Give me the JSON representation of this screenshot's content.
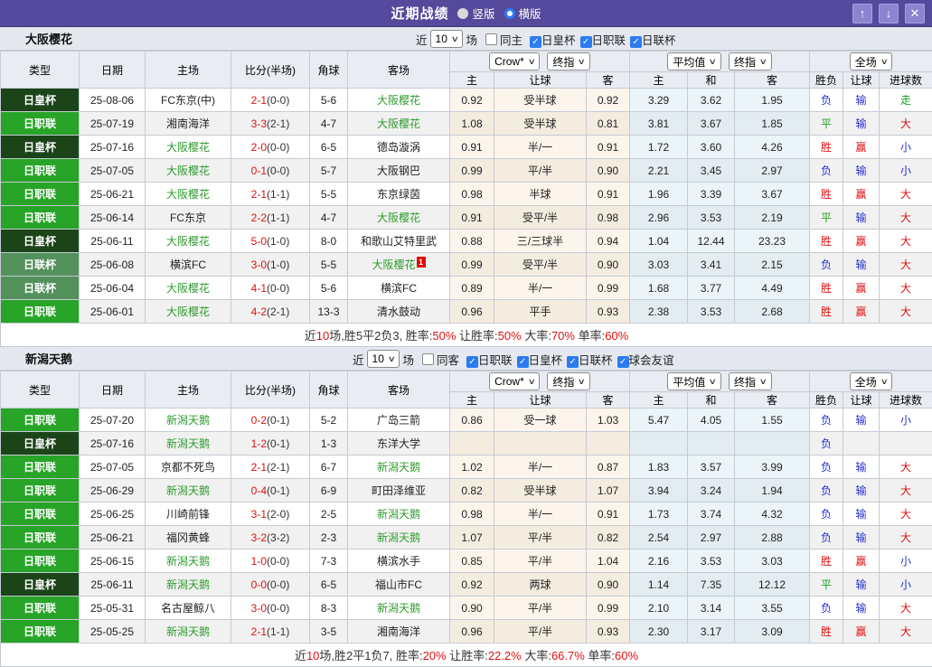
{
  "titlebar": {
    "title": "近期战绩",
    "radio_vertical": "竖版",
    "radio_horizontal": "横版",
    "up_icon": "↑",
    "down_icon": "↓",
    "close_icon": "✕"
  },
  "selects": {
    "crow": "Crow*",
    "final": "终指",
    "avg": "平均值",
    "full": "全场"
  },
  "filter_labels": {
    "near": "近",
    "games": "场"
  },
  "columns": [
    "类型",
    "日期",
    "主场",
    "比分(半场)",
    "角球",
    "客场",
    "主",
    "让球",
    "客",
    "主",
    "和",
    "客",
    "胜负",
    "让球",
    "进球数"
  ],
  "league_styles": {
    "日职联": "t-j1",
    "日皇杯": "t-cup",
    "日联杯": "t-lc"
  },
  "result_colors": {
    "胜": "res-red",
    "平": "res-green",
    "负": "res-blue",
    "赢": "res-red",
    "输": "res-blue",
    "大": "res-red",
    "小": "res-blue",
    "走": "res-green"
  },
  "sections": [
    {
      "team": "大阪樱花",
      "filters": {
        "count": "10",
        "same_label": "同主",
        "same_checked": false,
        "leagues": [
          "日皇杯",
          "日职联",
          "日联杯"
        ]
      },
      "rows": [
        {
          "league": "日皇杯",
          "date": "25-08-06",
          "home": "FC东京(中)",
          "score": "2-1",
          "half": "(0-0)",
          "corner": "5-6",
          "away": "大阪樱花",
          "badge": "",
          "crow_home": "0.92",
          "handicap": "受半球",
          "crow_away": "0.92",
          "avg_home": "3.29",
          "avg_draw": "3.62",
          "avg_away": "1.95",
          "result": "负",
          "handicap_result": "输",
          "goals_result": "走"
        },
        {
          "league": "日职联",
          "date": "25-07-19",
          "home": "湘南海洋",
          "score": "3-3",
          "half": "(2-1)",
          "corner": "4-7",
          "away": "大阪樱花",
          "badge": "",
          "crow_home": "1.08",
          "handicap": "受半球",
          "crow_away": "0.81",
          "avg_home": "3.81",
          "avg_draw": "3.67",
          "avg_away": "1.85",
          "result": "平",
          "handicap_result": "输",
          "goals_result": "大"
        },
        {
          "league": "日皇杯",
          "date": "25-07-16",
          "home": "大阪樱花",
          "score": "2-0",
          "half": "(0-0)",
          "corner": "6-5",
          "away": "德岛漩涡",
          "badge": "",
          "crow_home": "0.91",
          "handicap": "半/一",
          "crow_away": "0.91",
          "avg_home": "1.72",
          "avg_draw": "3.60",
          "avg_away": "4.26",
          "result": "胜",
          "handicap_result": "赢",
          "goals_result": "小"
        },
        {
          "league": "日职联",
          "date": "25-07-05",
          "home": "大阪樱花",
          "score": "0-1",
          "half": "(0-0)",
          "corner": "5-7",
          "away": "大阪钢巴",
          "badge": "",
          "crow_home": "0.99",
          "handicap": "平/半",
          "crow_away": "0.90",
          "avg_home": "2.21",
          "avg_draw": "3.45",
          "avg_away": "2.97",
          "result": "负",
          "handicap_result": "输",
          "goals_result": "小"
        },
        {
          "league": "日职联",
          "date": "25-06-21",
          "home": "大阪樱花",
          "score": "2-1",
          "half": "(1-1)",
          "corner": "5-5",
          "away": "东京绿茵",
          "badge": "",
          "crow_home": "0.98",
          "handicap": "半球",
          "crow_away": "0.91",
          "avg_home": "1.96",
          "avg_draw": "3.39",
          "avg_away": "3.67",
          "result": "胜",
          "handicap_result": "赢",
          "goals_result": "大"
        },
        {
          "league": "日职联",
          "date": "25-06-14",
          "home": "FC东京",
          "score": "2-2",
          "half": "(1-1)",
          "corner": "4-7",
          "away": "大阪樱花",
          "badge": "",
          "crow_home": "0.91",
          "handicap": "受平/半",
          "crow_away": "0.98",
          "avg_home": "2.96",
          "avg_draw": "3.53",
          "avg_away": "2.19",
          "result": "平",
          "handicap_result": "输",
          "goals_result": "大"
        },
        {
          "league": "日皇杯",
          "date": "25-06-11",
          "home": "大阪樱花",
          "score": "5-0",
          "half": "(1-0)",
          "corner": "8-0",
          "away": "和歌山艾特里武",
          "badge": "",
          "crow_home": "0.88",
          "handicap": "三/三球半",
          "crow_away": "0.94",
          "avg_home": "1.04",
          "avg_draw": "12.44",
          "avg_away": "23.23",
          "result": "胜",
          "handicap_result": "赢",
          "goals_result": "大"
        },
        {
          "league": "日联杯",
          "date": "25-06-08",
          "home": "横滨FC",
          "score": "3-0",
          "half": "(1-0)",
          "corner": "5-5",
          "away": "大阪樱花",
          "badge": "1",
          "crow_home": "0.99",
          "handicap": "受平/半",
          "crow_away": "0.90",
          "avg_home": "3.03",
          "avg_draw": "3.41",
          "avg_away": "2.15",
          "result": "负",
          "handicap_result": "输",
          "goals_result": "大"
        },
        {
          "league": "日联杯",
          "date": "25-06-04",
          "home": "大阪樱花",
          "score": "4-1",
          "half": "(0-0)",
          "corner": "5-6",
          "away": "横滨FC",
          "badge": "",
          "crow_home": "0.89",
          "handicap": "半/一",
          "crow_away": "0.99",
          "avg_home": "1.68",
          "avg_draw": "3.77",
          "avg_away": "4.49",
          "result": "胜",
          "handicap_result": "赢",
          "goals_result": "大"
        },
        {
          "league": "日职联",
          "date": "25-06-01",
          "home": "大阪樱花",
          "score": "4-2",
          "half": "(2-1)",
          "corner": "13-3",
          "away": "清水鼓动",
          "badge": "",
          "crow_home": "0.96",
          "handicap": "平手",
          "crow_away": "0.93",
          "avg_home": "2.38",
          "avg_draw": "3.53",
          "avg_away": "2.68",
          "result": "胜",
          "handicap_result": "赢",
          "goals_result": "大"
        }
      ],
      "summary": [
        {
          "text": "近",
          "red": false
        },
        {
          "text": "10",
          "red": true
        },
        {
          "text": "场,胜5平2负3, 胜率:",
          "red": false
        },
        {
          "text": "50%",
          "red": true
        },
        {
          "text": " 让胜率:",
          "red": false
        },
        {
          "text": "50%",
          "red": true
        },
        {
          "text": " 大率:",
          "red": false
        },
        {
          "text": "70%",
          "red": true
        },
        {
          "text": " 单率:",
          "red": false
        },
        {
          "text": "60%",
          "red": true
        }
      ]
    },
    {
      "team": "新潟天鹅",
      "filters": {
        "count": "10",
        "same_label": "同客",
        "same_checked": false,
        "leagues": [
          "日职联",
          "日皇杯",
          "日联杯",
          "球会友谊"
        ]
      },
      "rows": [
        {
          "league": "日职联",
          "date": "25-07-20",
          "home": "新潟天鹅",
          "score": "0-2",
          "half": "(0-1)",
          "corner": "5-2",
          "away": "广岛三箭",
          "badge": "",
          "crow_home": "0.86",
          "handicap": "受一球",
          "crow_away": "1.03",
          "avg_home": "5.47",
          "avg_draw": "4.05",
          "avg_away": "1.55",
          "result": "负",
          "handicap_result": "输",
          "goals_result": "小"
        },
        {
          "league": "日皇杯",
          "date": "25-07-16",
          "home": "新潟天鹅",
          "score": "1-2",
          "half": "(0-1)",
          "corner": "1-3",
          "away": "东洋大学",
          "badge": "",
          "crow_home": "",
          "handicap": "",
          "crow_away": "",
          "avg_home": "",
          "avg_draw": "",
          "avg_away": "",
          "result": "负",
          "handicap_result": "",
          "goals_result": ""
        },
        {
          "league": "日职联",
          "date": "25-07-05",
          "home": "京都不死鸟",
          "score": "2-1",
          "half": "(2-1)",
          "corner": "6-7",
          "away": "新潟天鹅",
          "badge": "",
          "crow_home": "1.02",
          "handicap": "半/一",
          "crow_away": "0.87",
          "avg_home": "1.83",
          "avg_draw": "3.57",
          "avg_away": "3.99",
          "result": "负",
          "handicap_result": "输",
          "goals_result": "大"
        },
        {
          "league": "日职联",
          "date": "25-06-29",
          "home": "新潟天鹅",
          "score": "0-4",
          "half": "(0-1)",
          "corner": "6-9",
          "away": "町田泽维亚",
          "badge": "",
          "crow_home": "0.82",
          "handicap": "受半球",
          "crow_away": "1.07",
          "avg_home": "3.94",
          "avg_draw": "3.24",
          "avg_away": "1.94",
          "result": "负",
          "handicap_result": "输",
          "goals_result": "大"
        },
        {
          "league": "日职联",
          "date": "25-06-25",
          "home": "川崎前锋",
          "score": "3-1",
          "half": "(2-0)",
          "corner": "2-5",
          "away": "新潟天鹅",
          "badge": "",
          "crow_home": "0.98",
          "handicap": "半/一",
          "crow_away": "0.91",
          "avg_home": "1.73",
          "avg_draw": "3.74",
          "avg_away": "4.32",
          "result": "负",
          "handicap_result": "输",
          "goals_result": "大"
        },
        {
          "league": "日职联",
          "date": "25-06-21",
          "home": "福冈黄蜂",
          "score": "3-2",
          "half": "(3-2)",
          "corner": "2-3",
          "away": "新潟天鹅",
          "badge": "",
          "crow_home": "1.07",
          "handicap": "平/半",
          "crow_away": "0.82",
          "avg_home": "2.54",
          "avg_draw": "2.97",
          "avg_away": "2.88",
          "result": "负",
          "handicap_result": "输",
          "goals_result": "大"
        },
        {
          "league": "日职联",
          "date": "25-06-15",
          "home": "新潟天鹅",
          "score": "1-0",
          "half": "(0-0)",
          "corner": "7-3",
          "away": "横滨水手",
          "badge": "",
          "crow_home": "0.85",
          "handicap": "平/半",
          "crow_away": "1.04",
          "avg_home": "2.16",
          "avg_draw": "3.53",
          "avg_away": "3.03",
          "result": "胜",
          "handicap_result": "赢",
          "goals_result": "小"
        },
        {
          "league": "日皇杯",
          "date": "25-06-11",
          "home": "新潟天鹅",
          "score": "0-0",
          "half": "(0-0)",
          "corner": "6-5",
          "away": "福山市FC",
          "badge": "",
          "crow_home": "0.92",
          "handicap": "两球",
          "crow_away": "0.90",
          "avg_home": "1.14",
          "avg_draw": "7.35",
          "avg_away": "12.12",
          "result": "平",
          "handicap_result": "输",
          "goals_result": "小"
        },
        {
          "league": "日职联",
          "date": "25-05-31",
          "home": "名古屋鲸八",
          "score": "3-0",
          "half": "(0-0)",
          "corner": "8-3",
          "away": "新潟天鹅",
          "badge": "",
          "crow_home": "0.90",
          "handicap": "平/半",
          "crow_away": "0.99",
          "avg_home": "2.10",
          "avg_draw": "3.14",
          "avg_away": "3.55",
          "result": "负",
          "handicap_result": "输",
          "goals_result": "大"
        },
        {
          "league": "日职联",
          "date": "25-05-25",
          "home": "新潟天鹅",
          "score": "2-1",
          "half": "(1-1)",
          "corner": "3-5",
          "away": "湘南海洋",
          "badge": "",
          "crow_home": "0.96",
          "handicap": "平/半",
          "crow_away": "0.93",
          "avg_home": "2.30",
          "avg_draw": "3.17",
          "avg_away": "3.09",
          "result": "胜",
          "handicap_result": "赢",
          "goals_result": "大"
        }
      ],
      "summary": [
        {
          "text": "近",
          "red": false
        },
        {
          "text": "10",
          "red": true
        },
        {
          "text": "场,胜2平1负7, 胜率:",
          "red": false
        },
        {
          "text": "20%",
          "red": true
        },
        {
          "text": " 让胜率:",
          "red": false
        },
        {
          "text": "22.2%",
          "red": true
        },
        {
          "text": " 大率:",
          "red": false
        },
        {
          "text": "66.7%",
          "red": true
        },
        {
          "text": " 单率:",
          "red": false
        },
        {
          "text": "60%",
          "red": true
        }
      ]
    }
  ]
}
